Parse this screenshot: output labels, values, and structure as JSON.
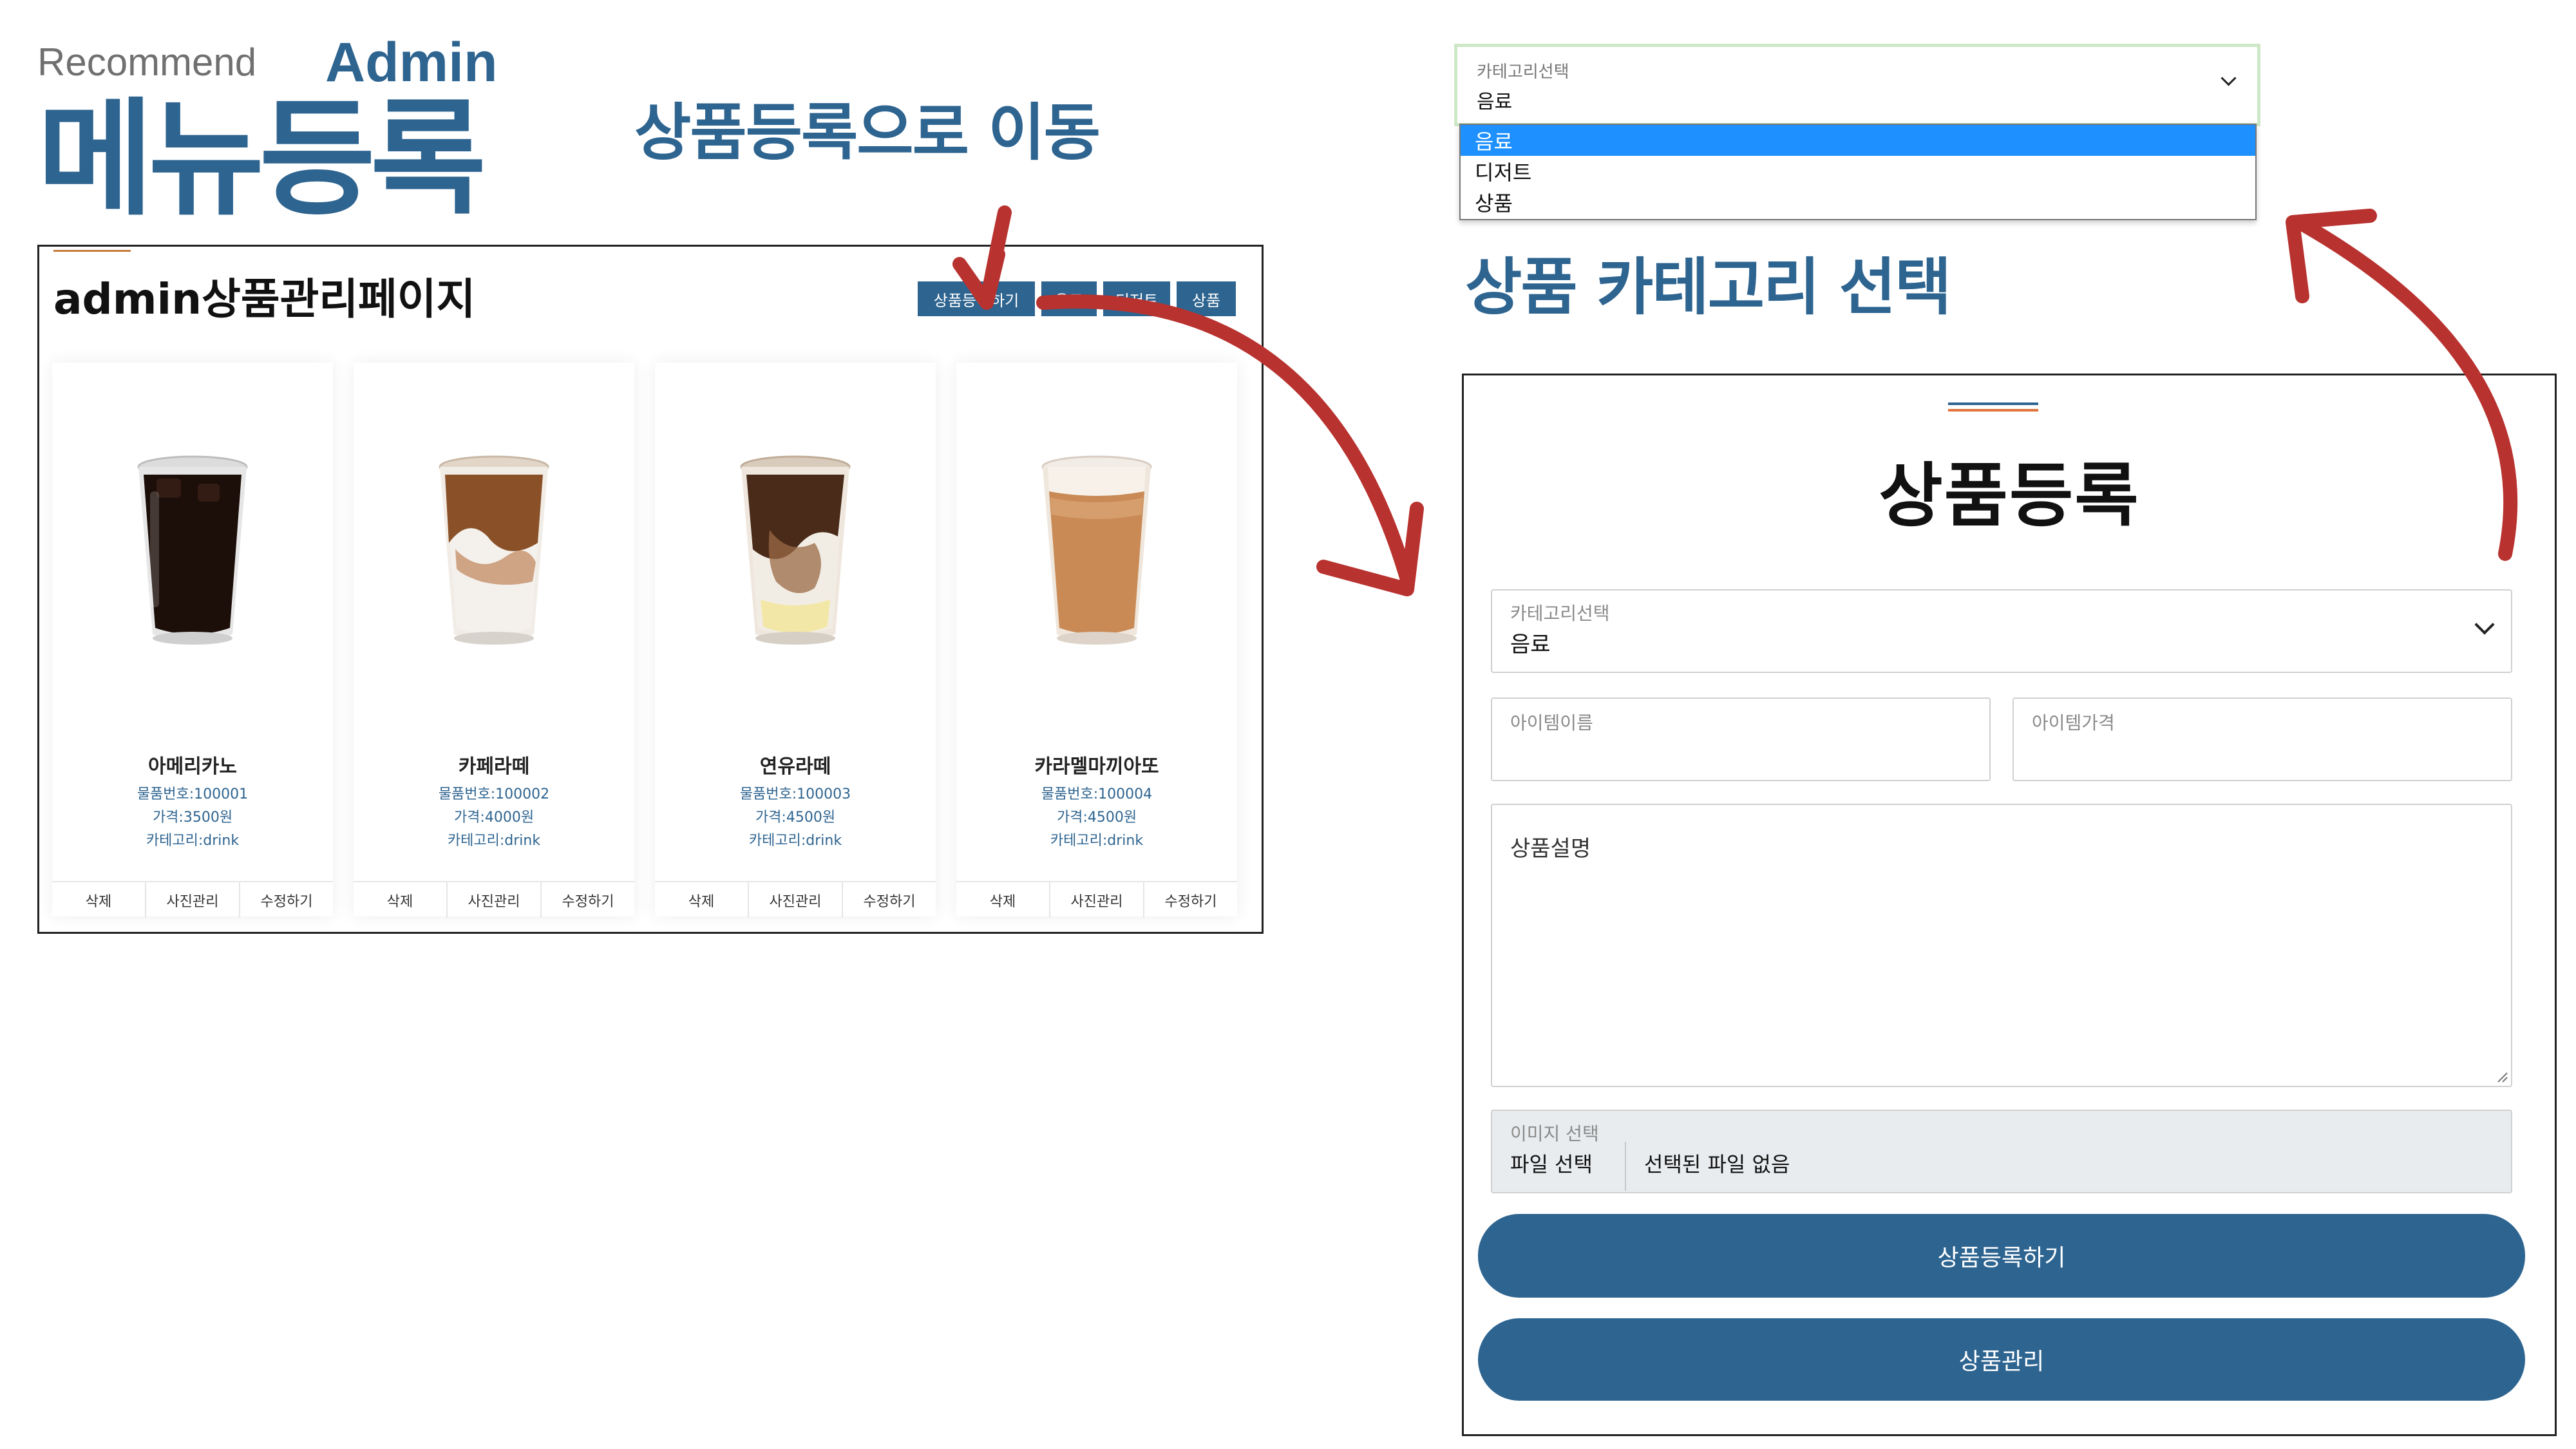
{
  "slide": {
    "recommend": "Recommend",
    "admin": "Admin",
    "title": "메뉴등록",
    "caption_move": "상품등록으로 이동",
    "caption_category": "상품 카테고리 선택"
  },
  "admin_page": {
    "heading": "admin상품관리페이지",
    "nav_buttons": [
      "상품등록하기",
      "음료",
      "디저트",
      "상품"
    ],
    "products": [
      {
        "name": "아메리카노",
        "number": "물품번호:100001",
        "price": "가격:3500원",
        "category": "카테고리:drink"
      },
      {
        "name": "카페라떼",
        "number": "물품번호:100002",
        "price": "가격:4000원",
        "category": "카테고리:drink"
      },
      {
        "name": "연유라떼",
        "number": "물품번호:100003",
        "price": "가격:4500원",
        "category": "카테고리:drink"
      },
      {
        "name": "카라멜마끼아또",
        "number": "물품번호:100004",
        "price": "가격:4500원",
        "category": "카테고리:drink"
      }
    ],
    "card_actions": [
      "삭제",
      "사진관리",
      "수정하기"
    ]
  },
  "category_dropdown": {
    "label": "카테고리선택",
    "value": "음료",
    "options": [
      "음료",
      "디저트",
      "상품"
    ],
    "selected_index": 0,
    "highlight_color": "#1e90ff"
  },
  "product_form": {
    "title": "상품등록",
    "category": {
      "label": "카테고리선택",
      "value": "음료"
    },
    "item_name_placeholder": "아이템이름",
    "item_price_placeholder": "아이템가격",
    "description_placeholder": "상품설명",
    "image": {
      "label": "이미지 선택",
      "button": "파일 선택",
      "status": "선택된 파일 없음"
    },
    "submit_button": "상품등록하기",
    "manage_button": "상품관리"
  },
  "colors": {
    "brand_blue": "#2e6490",
    "arrow_red": "#b8322f",
    "accent_orange": "#e0743a"
  },
  "icons": [
    "chevron-down-icon",
    "iced-americano-image",
    "iced-latte-image",
    "condensed-milk-latte-image",
    "caramel-macchiato-image",
    "curved-arrow"
  ]
}
